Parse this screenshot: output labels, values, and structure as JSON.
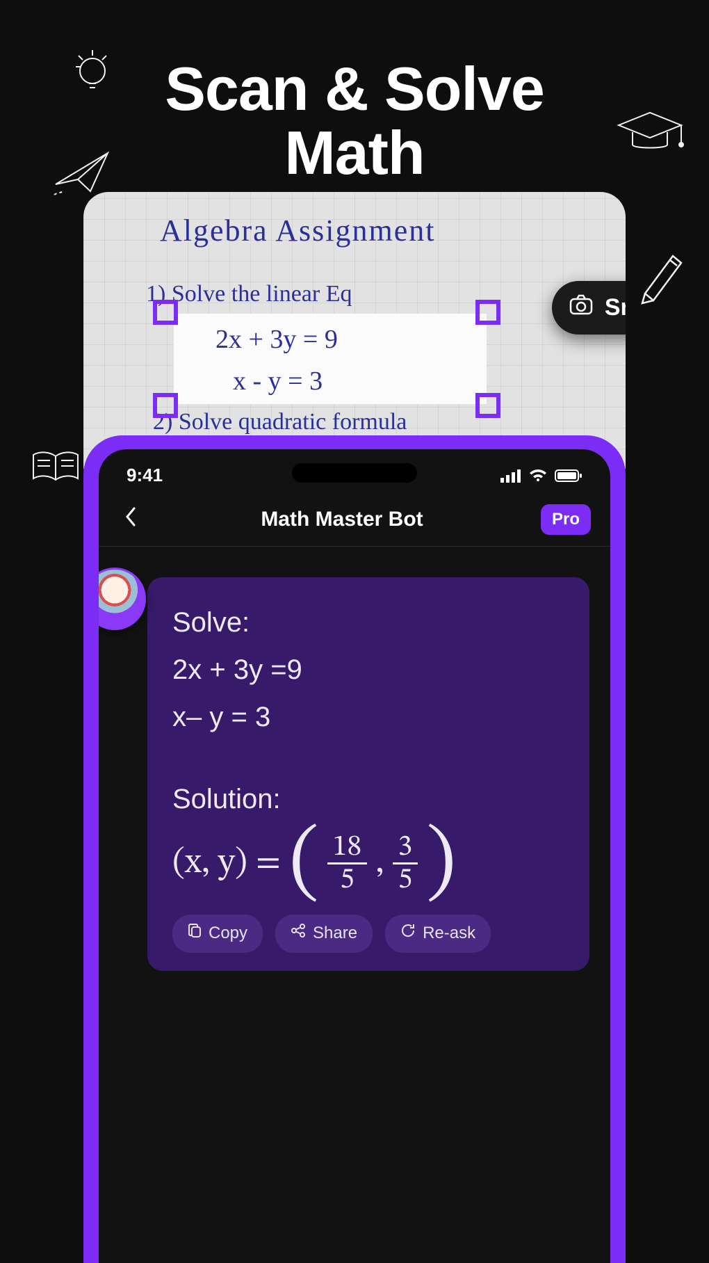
{
  "headline": {
    "line1": "Scan & Solve",
    "line2": "Math"
  },
  "scan": {
    "title": "Algebra  Assignment",
    "q1": "1)  Solve  the  linear  Eq",
    "eq1": "2x  +  3y   = 9",
    "eq2": "x  -   y    =  3",
    "q2": "2)  Solve  quadratic   formula",
    "snap_label": "Snap"
  },
  "phone": {
    "time": "9:41",
    "title": "Math Master Bot",
    "pro_label": "Pro"
  },
  "message": {
    "solve_label": "Solve:",
    "eq1": "2x + 3y =9",
    "eq2": "x– y = 3",
    "solution_label": "Solution:",
    "lhs": "(x, y)",
    "equals": "=",
    "frac1_num": "18",
    "frac1_den": "5",
    "comma": ",",
    "frac2_num": "3",
    "frac2_den": "5"
  },
  "actions": {
    "copy": "Copy",
    "share": "Share",
    "reask": "Re-ask"
  }
}
